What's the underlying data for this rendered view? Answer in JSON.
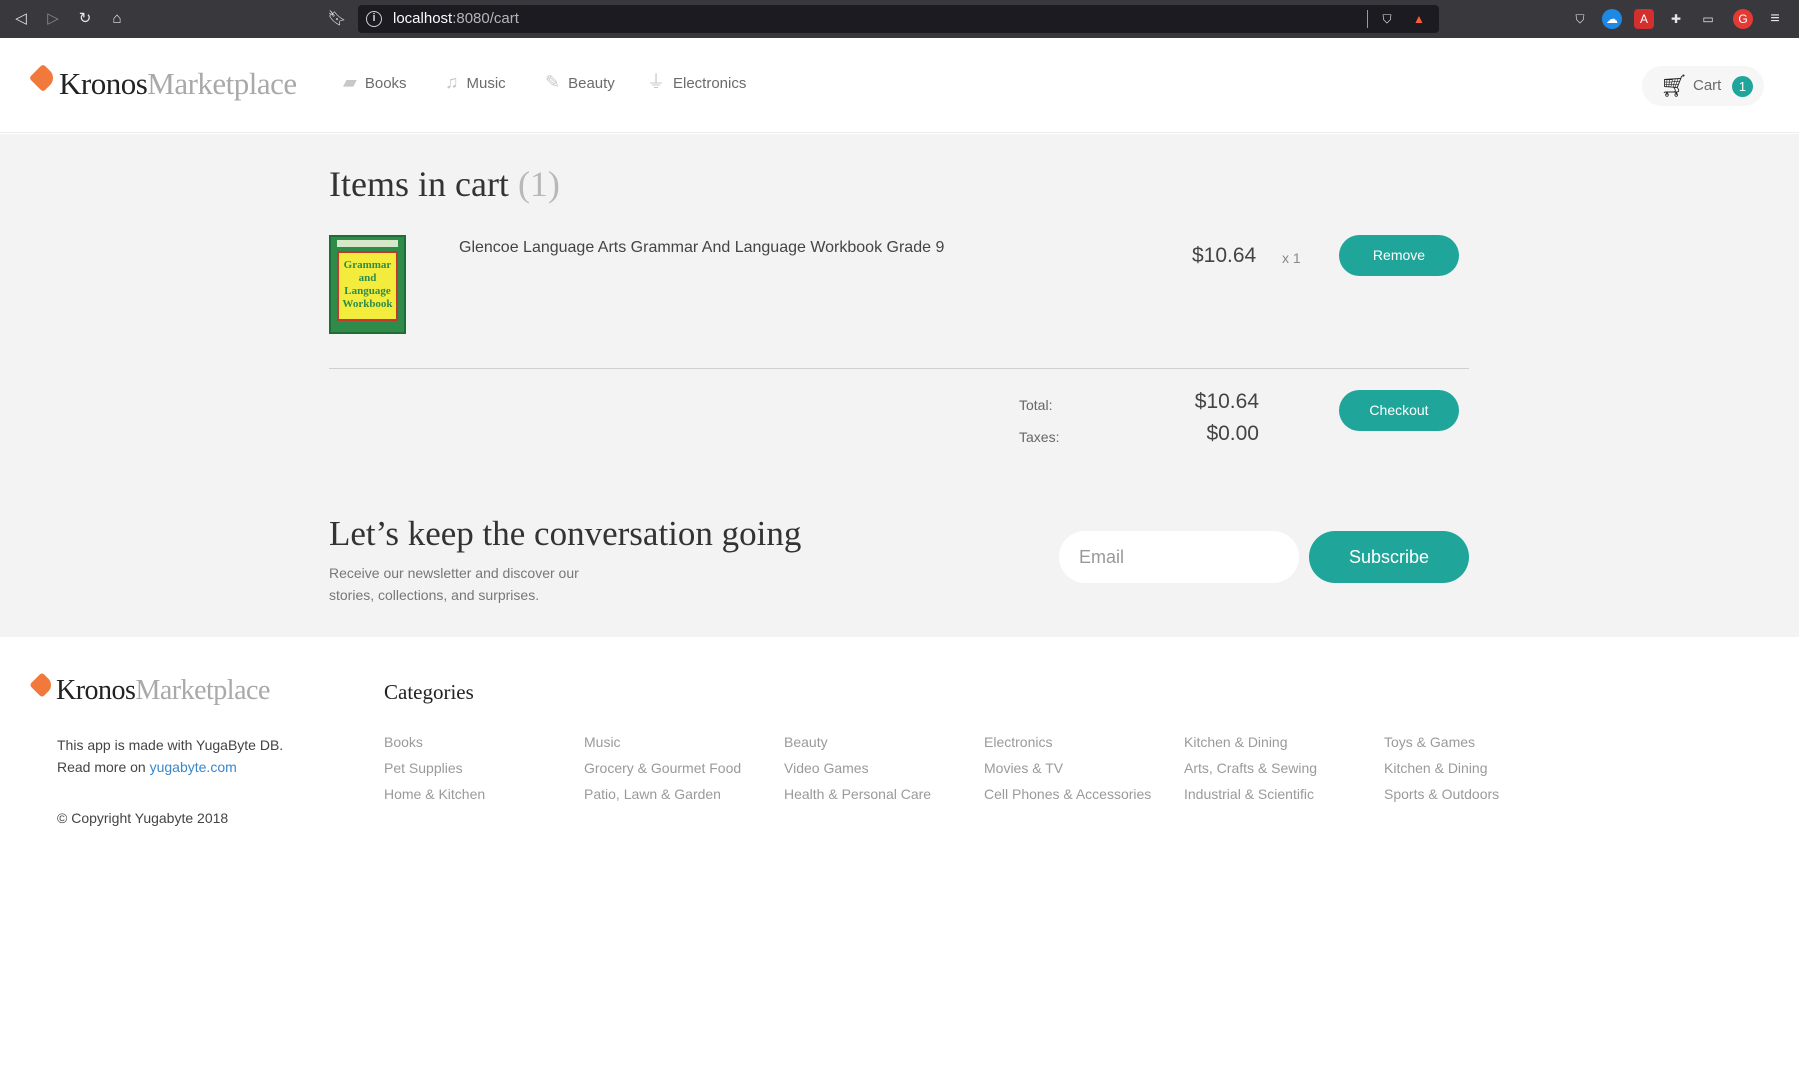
{
  "browser": {
    "url_host": "localhost",
    "url_path": ":8080/cart"
  },
  "header": {
    "logo_primary": "Kronos",
    "logo_secondary": "Marketplace",
    "nav": [
      {
        "label": "Books",
        "icon": "book-icon"
      },
      {
        "label": "Music",
        "icon": "music-note-icon"
      },
      {
        "label": "Beauty",
        "icon": "brush-icon"
      },
      {
        "label": "Electronics",
        "icon": "plug-icon"
      }
    ],
    "cart_label": "Cart",
    "cart_count": "1"
  },
  "cart": {
    "title": "Items in cart",
    "count_label": "(1)",
    "items": [
      {
        "name": "Glencoe Language Arts Grammar And Language Workbook Grade 9",
        "price": "$10.64",
        "quantity": "x 1",
        "thumb_text": "Grammar and Language Workbook"
      }
    ],
    "remove_label": "Remove",
    "total_label": "Total:",
    "total_value": "$10.64",
    "taxes_label": "Taxes:",
    "taxes_value": "$0.00",
    "checkout_label": "Checkout"
  },
  "newsletter": {
    "title": "Let’s keep the conversation going",
    "description": "Receive our newsletter and discover our stories, collections, and surprises.",
    "email_placeholder": "Email",
    "subscribe_label": "Subscribe"
  },
  "footer": {
    "logo_primary": "Kronos",
    "logo_secondary": "Marketplace",
    "about_line1": "This app is made with YugaByte DB.",
    "about_line2_prefix": "Read more on ",
    "about_link": "yugabyte.com",
    "copyright": "© Copyright Yugabyte 2018",
    "categories_title": "Categories",
    "categories": [
      [
        "Books",
        "Pet Supplies",
        "Home & Kitchen"
      ],
      [
        "Music",
        "Grocery & Gourmet Food",
        "Patio, Lawn & Garden"
      ],
      [
        "Beauty",
        "Video Games",
        "Health & Personal Care"
      ],
      [
        "Electronics",
        "Movies & TV",
        "Cell Phones & Accessories"
      ],
      [
        "Kitchen & Dining",
        "Arts, Crafts & Sewing",
        "Industrial & Scientific"
      ],
      [
        "Toys & Games",
        "Kitchen & Dining",
        "Sports & Outdoors"
      ]
    ]
  },
  "colors": {
    "accent": "#1fa59a",
    "logo_tag": "#f0793b",
    "main_bg": "#f3f3f3"
  }
}
